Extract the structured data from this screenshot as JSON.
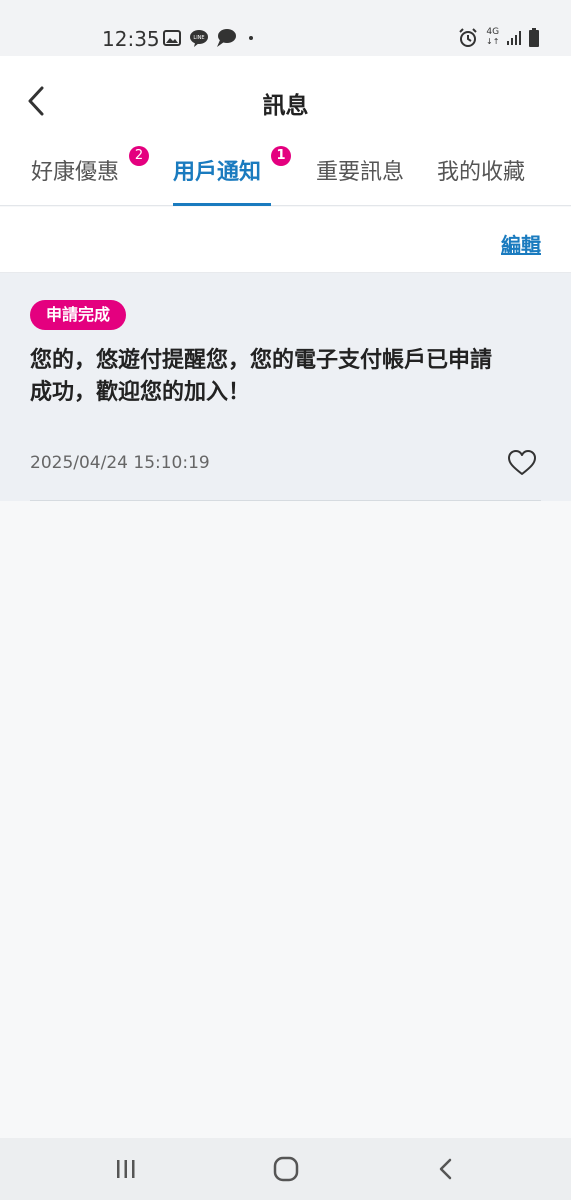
{
  "status_bar": {
    "time": "12:35",
    "icons": [
      "image-icon",
      "line-icon",
      "chat-icon",
      "dot-icon",
      "alarm-icon",
      "network-4g-icon",
      "signal-icon",
      "battery-icon"
    ],
    "network_label": "4G"
  },
  "header": {
    "title": "訊息",
    "back_icon": "chevron-left-icon"
  },
  "tabs": [
    {
      "label": "好康優惠",
      "badge": "2",
      "active": false
    },
    {
      "label": "用戶通知",
      "badge": "1",
      "active": true
    },
    {
      "label": "重要訊息",
      "badge": null,
      "active": false
    },
    {
      "label": "我的收藏",
      "badge": null,
      "active": false
    }
  ],
  "edit_label": "編輯",
  "messages": [
    {
      "tag": "申請完成",
      "text": "您的，悠遊付提醒您，您的電子支付帳戶已申請成功，歡迎您的加入！",
      "datetime": "2025/04/24  15:10:19",
      "favorite_icon": "heart-outline-icon"
    }
  ],
  "nav_bar": {
    "icons": [
      "recent-apps-icon",
      "home-icon",
      "back-icon"
    ]
  },
  "colors": {
    "accent_blue": "#1a7bbf",
    "badge_pink": "#e4007f",
    "card_bg": "#edf0f4"
  }
}
